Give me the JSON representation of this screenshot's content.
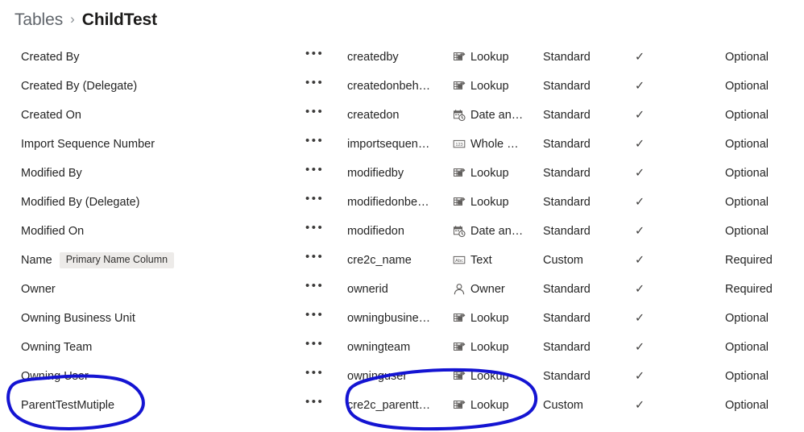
{
  "breadcrumb": {
    "root_label": "Tables",
    "separator": "›",
    "current_label": "ChildTest"
  },
  "grid": {
    "more_glyph": "•••",
    "check_glyph": "✓",
    "badge_primary_name": "Primary Name Column",
    "rows": [
      {
        "display_name": "Created By",
        "badge": "",
        "logical_name": "createdby",
        "data_type": "Lookup",
        "type_icon": "lookup-icon",
        "customization": "Standard",
        "searchable": true,
        "requirement": "Optional"
      },
      {
        "display_name": "Created By (Delegate)",
        "badge": "",
        "logical_name": "createdonbeh…",
        "data_type": "Lookup",
        "type_icon": "lookup-icon",
        "customization": "Standard",
        "searchable": true,
        "requirement": "Optional"
      },
      {
        "display_name": "Created On",
        "badge": "",
        "logical_name": "createdon",
        "data_type": "Date an…",
        "type_icon": "date-time-icon",
        "customization": "Standard",
        "searchable": true,
        "requirement": "Optional"
      },
      {
        "display_name": "Import Sequence Number",
        "badge": "",
        "logical_name": "importsequen…",
        "data_type": "Whole …",
        "type_icon": "whole-number-icon",
        "customization": "Standard",
        "searchable": true,
        "requirement": "Optional"
      },
      {
        "display_name": "Modified By",
        "badge": "",
        "logical_name": "modifiedby",
        "data_type": "Lookup",
        "type_icon": "lookup-icon",
        "customization": "Standard",
        "searchable": true,
        "requirement": "Optional"
      },
      {
        "display_name": "Modified By (Delegate)",
        "badge": "",
        "logical_name": "modifiedonbe…",
        "data_type": "Lookup",
        "type_icon": "lookup-icon",
        "customization": "Standard",
        "searchable": true,
        "requirement": "Optional"
      },
      {
        "display_name": "Modified On",
        "badge": "",
        "logical_name": "modifiedon",
        "data_type": "Date an…",
        "type_icon": "date-time-icon",
        "customization": "Standard",
        "searchable": true,
        "requirement": "Optional"
      },
      {
        "display_name": "Name",
        "badge": "Primary Name Column",
        "logical_name": "cre2c_name",
        "data_type": "Text",
        "type_icon": "text-icon",
        "customization": "Custom",
        "searchable": true,
        "requirement": "Required"
      },
      {
        "display_name": "Owner",
        "badge": "",
        "logical_name": "ownerid",
        "data_type": "Owner",
        "type_icon": "owner-icon",
        "customization": "Standard",
        "searchable": true,
        "requirement": "Required"
      },
      {
        "display_name": "Owning Business Unit",
        "badge": "",
        "logical_name": "owningbusine…",
        "data_type": "Lookup",
        "type_icon": "lookup-icon",
        "customization": "Standard",
        "searchable": true,
        "requirement": "Optional"
      },
      {
        "display_name": "Owning Team",
        "badge": "",
        "logical_name": "owningteam",
        "data_type": "Lookup",
        "type_icon": "lookup-icon",
        "customization": "Standard",
        "searchable": true,
        "requirement": "Optional"
      },
      {
        "display_name": "Owning User",
        "badge": "",
        "logical_name": "owninguser",
        "data_type": "Lookup",
        "type_icon": "lookup-icon",
        "customization": "Standard",
        "searchable": true,
        "requirement": "Optional"
      },
      {
        "display_name": "ParentTestMutiple",
        "badge": "",
        "logical_name": "cre2c_parentt…",
        "data_type": "Lookup",
        "type_icon": "lookup-icon",
        "customization": "Custom",
        "searchable": true,
        "requirement": "Optional"
      }
    ]
  },
  "annotations": {
    "ink_color": "#1414D2",
    "stroke_width": 4,
    "circled_display_name": "ParentTestMutiple",
    "circled_logical_and_type": "cre2c_parentt… / Lookup"
  }
}
